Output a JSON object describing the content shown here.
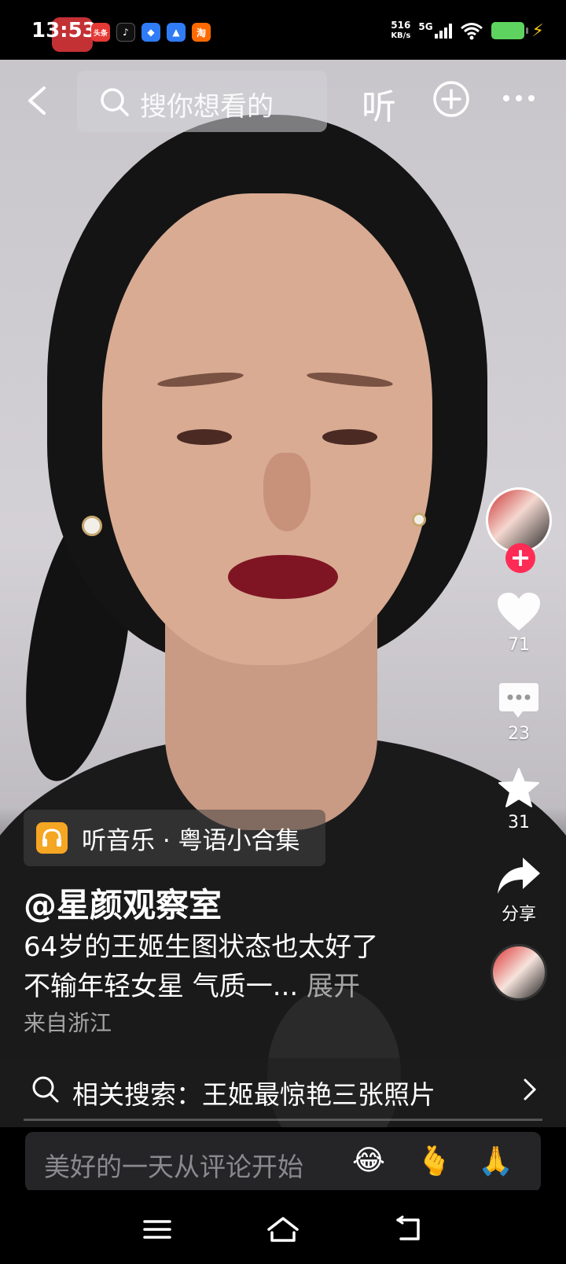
{
  "status_bar": {
    "time": "13:53",
    "net_speed_value": "516",
    "net_speed_unit": "KB/s",
    "network": "5G",
    "notification_apps": [
      "头条",
      "抖音",
      "应用",
      "钉钉",
      "淘"
    ]
  },
  "top_nav": {
    "search_placeholder": "搜你想看的",
    "listen_label": "听"
  },
  "right_rail": {
    "likes": "71",
    "comments": "23",
    "favorites": "31",
    "share_label": "分享"
  },
  "video_info": {
    "music_tag": "听音乐 · 粤语小合集",
    "author": "@星颜观察室",
    "desc_line1": "64岁的王姬生图状态也太好了",
    "desc_line2": "不输年轻女星 气质一...",
    "expand_label": "展开",
    "location": "来自浙江"
  },
  "related_search": {
    "text": "相关搜索：王姬最惊艳三张照片"
  },
  "comment_bar": {
    "placeholder": "美好的一天从评论开始",
    "emojis": [
      "😂",
      "🫰",
      "🙏"
    ]
  },
  "colors": {
    "accent_red": "#fe2c55",
    "battery_green": "#5fd35f",
    "music_orange": "#f5a623"
  }
}
